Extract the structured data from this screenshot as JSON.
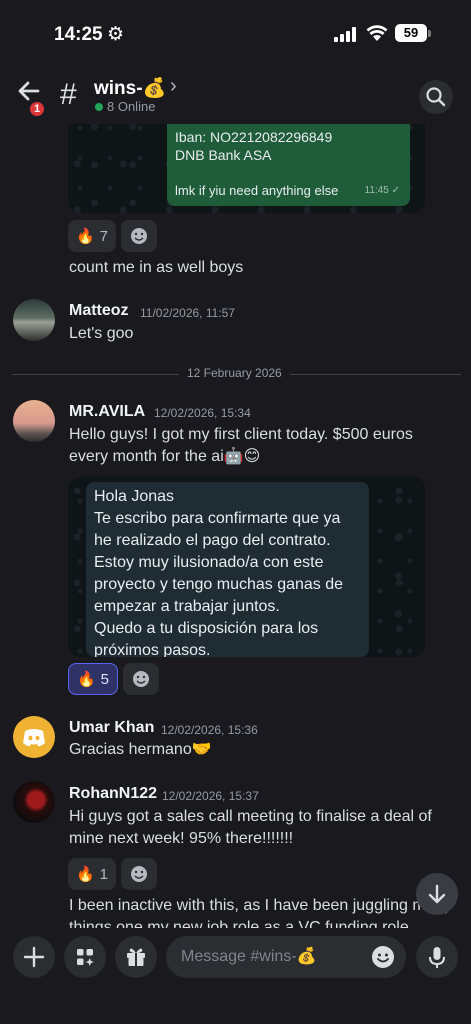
{
  "status_bar": {
    "time": "14:25",
    "battery": "59"
  },
  "header": {
    "badge_count": "1",
    "channel_name": "wins-💰",
    "online_text": "8 Online"
  },
  "messages": {
    "bank_card": {
      "line1": "Iban: NO2212082296849",
      "line2": "DNB Bank ASA",
      "line3": "lmk if yiu need anything else",
      "time": "11:45 ✓"
    },
    "reaction_fire_1": {
      "emoji": "🔥",
      "count": "7"
    },
    "count_me_in": "count me in as well boys",
    "matteoz": {
      "name": "Matteoz",
      "timestamp": "11/02/2026, 11:57",
      "text": "Let's goo"
    },
    "date_divider": "12 February 2026",
    "avila": {
      "name": "MR.AVILA",
      "timestamp": "12/02/2026, 15:34",
      "text_line1": "Hello guys! I got my first client today. $500 euros",
      "text_line2": "every month for the ai🤖😊",
      "card_lines": [
        "Hola Jonas",
        "Te escribo para confirmarte que ya",
        "he realizado el pago del contrato.",
        "Estoy muy ilusionado/a con este",
        "proyecto y tengo muchas ganas de",
        "empezar a trabajar juntos.",
        "Quedo a tu disposición para los",
        "próximos pasos."
      ],
      "reaction": {
        "emoji": "🔥",
        "count": "5"
      }
    },
    "umar": {
      "name": "Umar Khan",
      "timestamp": "12/02/2026, 15:36",
      "text": "Gracias hermano🤝"
    },
    "rohan": {
      "name": "RohanN122",
      "timestamp": "12/02/2026, 15:37",
      "text_line1": "Hi guys got a sales call meeting to finalise a deal of",
      "text_line2": "mine next week! 95% there!!!!!!!",
      "reaction": {
        "emoji": "🔥",
        "count": "1"
      },
      "next_line1": "I been inactive with this, as I have been juggling many",
      "next_line2": "things one my new job role as a VC funding role"
    }
  },
  "composer": {
    "placeholder": "Message #wins-💰"
  },
  "colors": {
    "background": "#1a1a1e",
    "accent": "#5865f2",
    "online": "#23a55a",
    "badge": "#da373c"
  }
}
